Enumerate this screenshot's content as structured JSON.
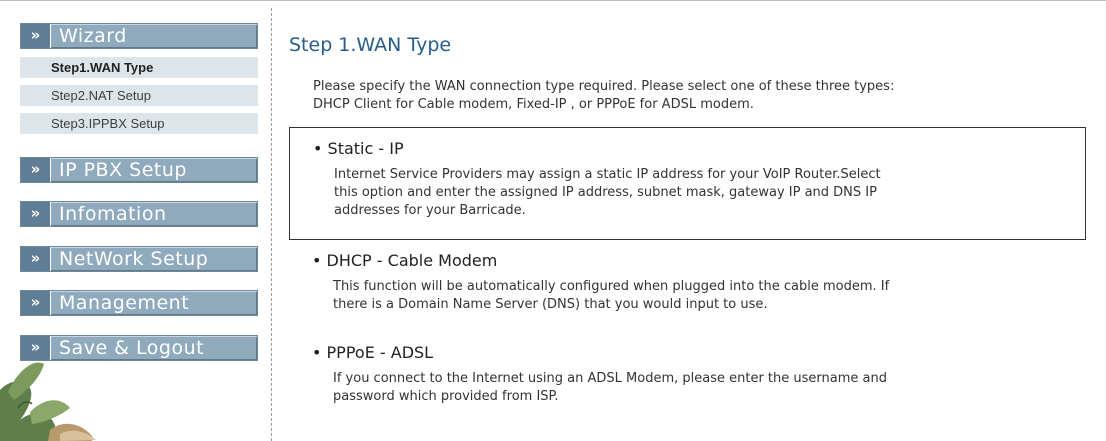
{
  "sidebar": {
    "wizard_label": "Wizard",
    "arrow_glyph": "»",
    "wizard_items": [
      "Step1.WAN Type",
      "Step2.NAT Setup",
      "Step3.IPPBX Setup"
    ],
    "menus": [
      "IP PBX Setup",
      "Infomation",
      "NetWork Setup",
      "Management",
      "Save & Logout"
    ]
  },
  "main": {
    "title": "Step 1.WAN Type",
    "intro_lines": [
      "Please specify the WAN connection type required. Please select one of these three types:",
      "DHCP Client for Cable modem, Fixed-IP , or PPPoE for ADSL modem."
    ],
    "options": [
      {
        "title": "Static - IP",
        "lines": [
          "Internet Service Providers may assign a static IP address for your VoIP Router.Select",
          "this option and enter the assigned IP address, subnet mask, gateway IP and DNS IP",
          "addresses for your Barricade."
        ]
      },
      {
        "title": "DHCP - Cable Modem",
        "lines": [
          "This function will be automatically configured when plugged into the cable modem. If",
          "there is a Domain Name Server (DNS) that you would input to use."
        ]
      },
      {
        "title": "PPPoE - ADSL",
        "lines": [
          "If you connect to the Internet using an ADSL Modem, please enter the username and",
          "password which provided from ISP."
        ]
      }
    ]
  },
  "colors": {
    "accent_blue": "#275d8c",
    "menu_bg": "#8fa9bd",
    "menu_arrow_bg": "#5f7d95",
    "sub_bg": "#dde5eb"
  }
}
